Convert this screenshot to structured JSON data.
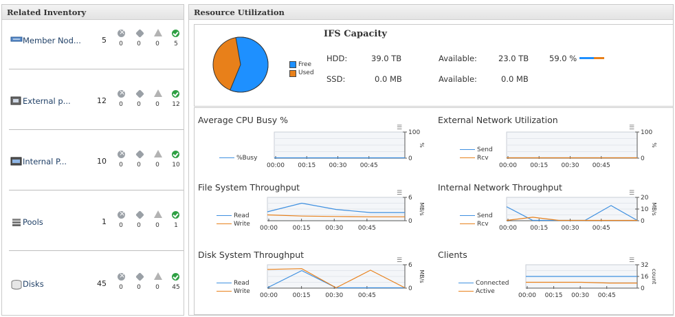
{
  "related_inventory": {
    "title": "Related Inventory",
    "items": [
      {
        "label": "Member Nod...",
        "count": "5",
        "icon": "storage-node-icon",
        "critical": "0",
        "major": "0",
        "warning": "0",
        "normal": "5"
      },
      {
        "label": "External p...",
        "count": "12",
        "icon": "network-port-icon",
        "critical": "0",
        "major": "0",
        "warning": "0",
        "normal": "12"
      },
      {
        "label": "Internal P...",
        "count": "10",
        "icon": "internal-port-icon",
        "critical": "0",
        "major": "0",
        "warning": "0",
        "normal": "10"
      },
      {
        "label": "Pools",
        "count": "1",
        "icon": "pool-icon",
        "critical": "0",
        "major": "0",
        "warning": "0",
        "normal": "1"
      },
      {
        "label": "Disks",
        "count": "45",
        "icon": "disk-icon",
        "critical": "0",
        "major": "0",
        "warning": "0",
        "normal": "45"
      }
    ]
  },
  "resource_utilization": {
    "title": "Resource Utilization",
    "ifs": {
      "title": "IFS Capacity",
      "legend_free": "Free",
      "legend_used": "Used",
      "free_color": "#1e90ff",
      "used_color": "#e8801a",
      "free_fraction": 0.59,
      "hdd_label": "HDD:",
      "hdd_value": "39.0 TB",
      "hdd_available_label": "Available:",
      "hdd_available_value": "23.0 TB",
      "ssd_label": "SSD:",
      "ssd_value": "0.0 MB",
      "ssd_available_label": "Available:",
      "ssd_available_value": "0.0 MB",
      "percent": "59.0 %"
    },
    "time_ticks": [
      "00:00",
      "00:15",
      "00:30",
      "00:45"
    ]
  },
  "chart_data": [
    {
      "type": "line",
      "title": "Average CPU Busy %",
      "ylabel": "%",
      "ylim": [
        0,
        100
      ],
      "ytick_labels": [
        "100",
        "0"
      ],
      "series": [
        {
          "name": "%Busy",
          "color": "#3d8fe0",
          "values": [
            0,
            0,
            0,
            0,
            0
          ]
        }
      ]
    },
    {
      "type": "line",
      "title": "External Network Utilization",
      "ylabel": "%",
      "ylim": [
        0,
        100
      ],
      "ytick_labels": [
        "100",
        "0"
      ],
      "series": [
        {
          "name": "Send",
          "color": "#3d8fe0",
          "values": [
            0,
            0,
            0,
            0,
            0
          ]
        },
        {
          "name": "Rcv",
          "color": "#e8801a",
          "values": [
            0,
            0,
            0,
            0,
            0
          ]
        }
      ]
    },
    {
      "type": "line",
      "title": "File System Throughput",
      "ylabel": "MB/s",
      "ylim": [
        0,
        6
      ],
      "ytick_labels": [
        "6",
        "0"
      ],
      "series": [
        {
          "name": "Read",
          "color": "#3d8fe0",
          "values": [
            2.3,
            4.5,
            2.9,
            2.1,
            2.1
          ]
        },
        {
          "name": "Write",
          "color": "#e8801a",
          "values": [
            1.5,
            1.2,
            1.1,
            1.0,
            1.0
          ]
        }
      ]
    },
    {
      "type": "line",
      "title": "Internal Network Throughput",
      "ylabel": "MB/s",
      "ylim": [
        0,
        20
      ],
      "ytick_labels": [
        "20",
        "10",
        "0"
      ],
      "series": [
        {
          "name": "Send",
          "color": "#3d8fe0",
          "values": [
            12,
            0,
            0,
            0,
            13,
            0
          ]
        },
        {
          "name": "Rcv",
          "color": "#e8801a",
          "values": [
            0,
            3,
            0,
            0,
            0,
            0
          ]
        }
      ]
    },
    {
      "type": "line",
      "title": "Disk System Throughput",
      "ylabel": "MB/s",
      "ylim": [
        0,
        6
      ],
      "ytick_labels": [
        "6",
        "0"
      ],
      "series": [
        {
          "name": "Read",
          "color": "#3d8fe0",
          "values": [
            0,
            4.5,
            0,
            0,
            0
          ]
        },
        {
          "name": "Write",
          "color": "#e8801a",
          "values": [
            4.8,
            5.0,
            0,
            4.6,
            0
          ]
        }
      ]
    },
    {
      "type": "line",
      "title": "Clients",
      "ylabel": "count",
      "ylim": [
        0,
        32
      ],
      "ytick_labels": [
        "32",
        "16",
        "0"
      ],
      "series": [
        {
          "name": "Connected",
          "color": "#3d8fe0",
          "values": [
            16,
            16,
            16,
            16,
            16
          ]
        },
        {
          "name": "Active",
          "color": "#e8801a",
          "values": [
            8,
            8,
            8,
            7,
            7
          ]
        }
      ]
    }
  ]
}
